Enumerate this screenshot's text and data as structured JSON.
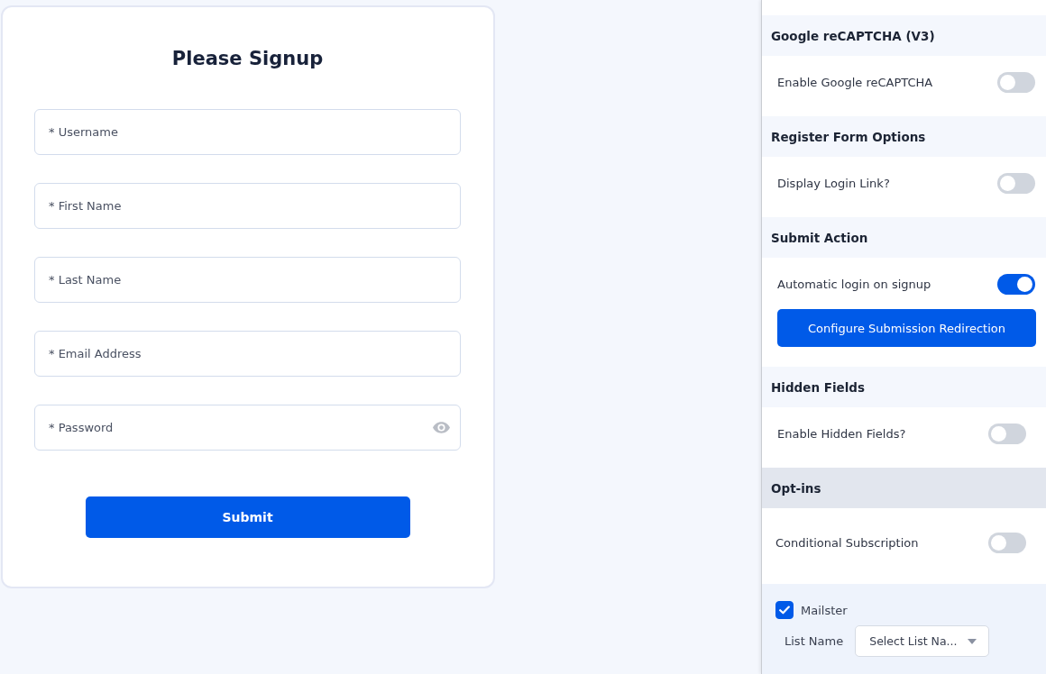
{
  "signup_form": {
    "title": "Please Signup",
    "fields": [
      {
        "kind": "text",
        "placeholder": "* Username"
      },
      {
        "kind": "text",
        "placeholder": "* First Name"
      },
      {
        "kind": "text",
        "placeholder": "* Last Name"
      },
      {
        "kind": "text",
        "placeholder": "* Email Address"
      },
      {
        "kind": "password",
        "placeholder": "* Password"
      }
    ],
    "submit_button": "Submit"
  },
  "settings_panel": {
    "sections": [
      {
        "title": "Google reCAPTCHA (V3)",
        "highlighted": false,
        "items": [
          {
            "kind": "toggle",
            "label": "Enable Google reCAPTCHA",
            "on": false
          }
        ]
      },
      {
        "title": "Register Form Options",
        "highlighted": false,
        "items": [
          {
            "kind": "toggle",
            "label": "Display Login Link?",
            "on": false
          }
        ]
      },
      {
        "title": "Submit Action",
        "highlighted": false,
        "items": [
          {
            "kind": "toggle",
            "label": "Automatic login on signup",
            "on": true
          },
          {
            "kind": "button",
            "label": "Configure Submission Redirection"
          }
        ]
      },
      {
        "title": "Hidden Fields",
        "highlighted": false,
        "items": [
          {
            "kind": "toggle",
            "label": "Enable Hidden Fields?",
            "on": false
          }
        ]
      },
      {
        "title": "Opt-ins",
        "highlighted": true,
        "items": [
          {
            "kind": "toggle",
            "label": "Conditional Subscription",
            "on": false
          },
          {
            "kind": "provider",
            "label": "Mailster",
            "checked": true,
            "list_label": "List Name",
            "list_select": "Select List Na..."
          }
        ]
      }
    ]
  }
}
